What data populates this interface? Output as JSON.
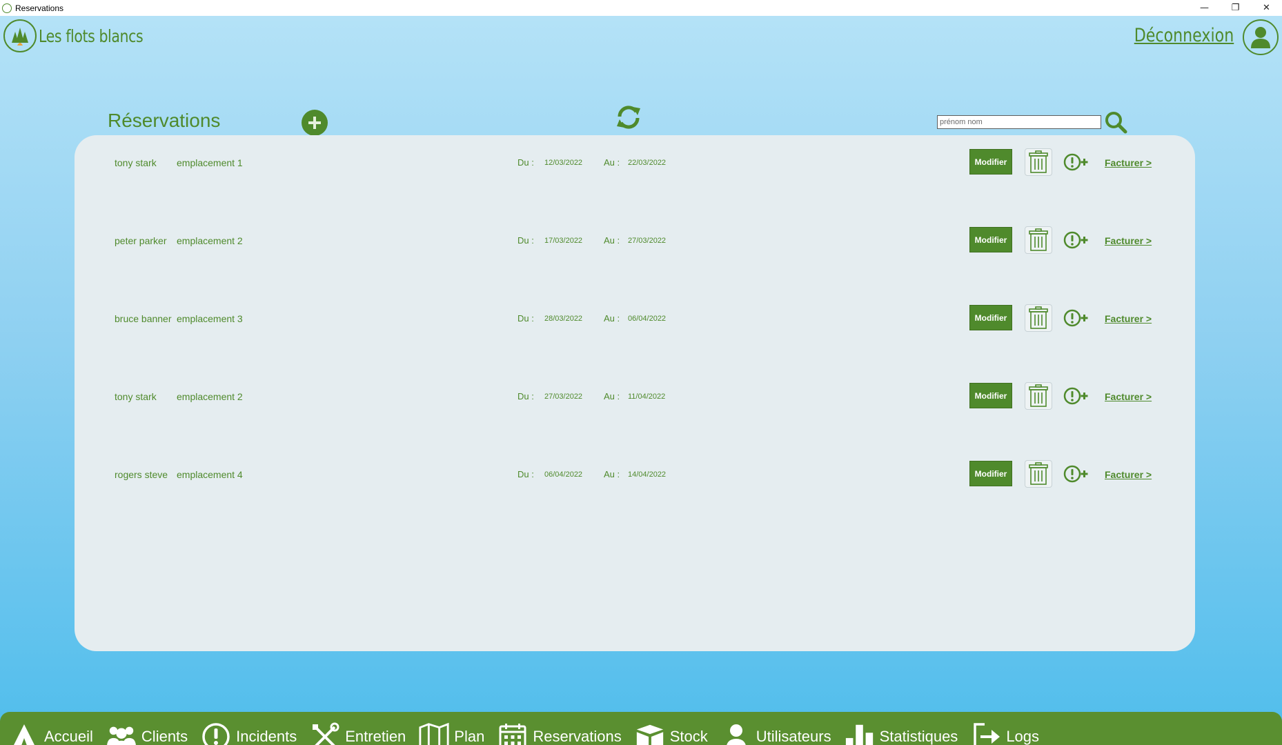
{
  "window": {
    "title": "Reservations",
    "minimize_glyph": "—",
    "maximize_glyph": "❐",
    "close_glyph": "✕"
  },
  "header": {
    "brand": "Les flots blancs",
    "logout_label": "Déconnexion",
    "logo_icon": "tent-forest-logo-icon",
    "avatar_icon": "user-avatar-icon"
  },
  "toolbar": {
    "title": "Réservations",
    "search_placeholder": "prénom nom",
    "search_value": ""
  },
  "reservations": {
    "labels": {
      "du": "Du :",
      "au": "Au :",
      "edit": "Modifier",
      "bill": "Facturer >"
    },
    "rows": [
      {
        "name": "tony stark",
        "place": "emplacement 1",
        "from": "12/03/2022",
        "to": "22/03/2022"
      },
      {
        "name": "peter parker",
        "place": "emplacement 2",
        "from": "17/03/2022",
        "to": "27/03/2022"
      },
      {
        "name": "bruce banner",
        "place": "emplacement 3",
        "from": "28/03/2022",
        "to": "06/04/2022"
      },
      {
        "name": "tony stark",
        "place": "emplacement 2",
        "from": "27/03/2022",
        "to": "11/04/2022"
      },
      {
        "name": "rogers steve",
        "place": "emplacement 4",
        "from": "06/04/2022",
        "to": "14/04/2022"
      }
    ]
  },
  "nav": {
    "items": [
      {
        "label": "Accueil",
        "icon": "tent-icon"
      },
      {
        "label": "Clients",
        "icon": "users-icon"
      },
      {
        "label": "Incidents",
        "icon": "alert-circle-icon"
      },
      {
        "label": "Entretien",
        "icon": "tools-icon"
      },
      {
        "label": "Plan",
        "icon": "map-icon"
      },
      {
        "label": "Reservations",
        "icon": "calendar-icon"
      },
      {
        "label": "Stock",
        "icon": "boxes-icon"
      },
      {
        "label": "Utilisateurs",
        "icon": "user-icon"
      },
      {
        "label": "Statistiques",
        "icon": "bar-chart-icon"
      },
      {
        "label": "Logs",
        "icon": "exit-icon"
      }
    ]
  },
  "colors": {
    "accent": "#4f8a2c",
    "nav_bg": "#5a8f30",
    "panel": "#e5edf0",
    "sky_top": "#b4e2f7",
    "sky_bottom": "#4fbdec"
  }
}
